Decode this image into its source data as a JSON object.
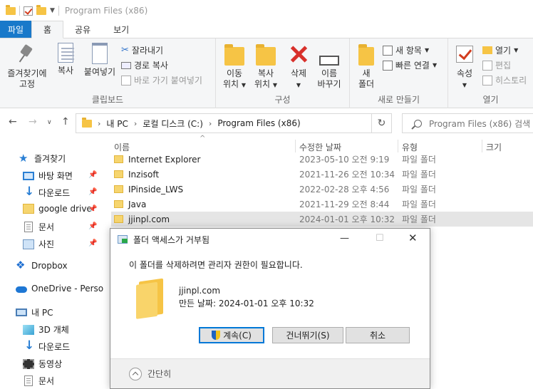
{
  "window": {
    "title": "Program Files (x86)"
  },
  "tabs": [
    "파일",
    "홈",
    "공유",
    "보기"
  ],
  "ribbon": {
    "clipboard": {
      "pin_label_1": "즐겨찾기에",
      "pin_label_2": "고정",
      "copy_label": "복사",
      "paste_label": "붙여넣기",
      "cut_label": "잘라내기",
      "copy_path_label": "경로 복사",
      "paste_shortcut_label": "바로 가기 붙여넣기",
      "group_label": "클립보드"
    },
    "organize": {
      "move_label_1": "이동",
      "move_label_2": "위치",
      "copyto_label_1": "복사",
      "copyto_label_2": "위치",
      "delete_label": "삭제",
      "rename_label_1": "이름",
      "rename_label_2": "바꾸기",
      "group_label": "구성"
    },
    "new": {
      "new_folder_label_1": "새",
      "new_folder_label_2": "폴더",
      "new_item_label": "새 항목",
      "easy_access_label": "빠른 연결",
      "group_label": "새로 만들기"
    },
    "open": {
      "properties_label": "속성",
      "open_label": "열기",
      "edit_label": "편집",
      "history_label": "히스토리",
      "group_label": "열기"
    }
  },
  "address": {
    "crumbs": [
      "내 PC",
      "로컬 디스크 (C:)",
      "Program Files (x86)"
    ],
    "search_placeholder": "Program Files (x86) 검색"
  },
  "nav": {
    "quick_access": "즐겨찾기",
    "desktop": "바탕 화면",
    "downloads": "다운로드",
    "google_drive": "google drive",
    "documents": "문서",
    "pictures": "사진",
    "dropbox": "Dropbox",
    "onedrive": "OneDrive - Perso",
    "this_pc": "내 PC",
    "objects3d": "3D 개체",
    "pc_downloads": "다운로드",
    "videos": "동영상",
    "pc_documents": "문서"
  },
  "columns": {
    "name": "이름",
    "date": "수정한 날짜",
    "type": "유형",
    "size": "크기"
  },
  "files": [
    {
      "name": "Internet Explorer",
      "date": "2023-05-10 오전 9:19",
      "type": "파일 폴더"
    },
    {
      "name": "Inzisoft",
      "date": "2021-11-26 오전 10:34",
      "type": "파일 폴더"
    },
    {
      "name": "IPinside_LWS",
      "date": "2022-02-28 오후 4:56",
      "type": "파일 폴더"
    },
    {
      "name": "Java",
      "date": "2021-11-29 오전 8:44",
      "type": "파일 폴더"
    },
    {
      "name": "jjinpl.com",
      "date": "2024-01-01 오후 10:32",
      "type": "파일 폴더"
    }
  ],
  "dialog": {
    "title": "폴더 액세스가 거부됨",
    "message": "이 폴더를 삭제하려면 관리자 권한이 필요합니다.",
    "folder_name": "jjinpl.com",
    "folder_created": "만든 날짜: 2024-01-01 오후 10:32",
    "continue_label": "계속(C)",
    "skip_label": "건너뛰기(S)",
    "cancel_label": "취소",
    "collapse_label": "간단히"
  }
}
